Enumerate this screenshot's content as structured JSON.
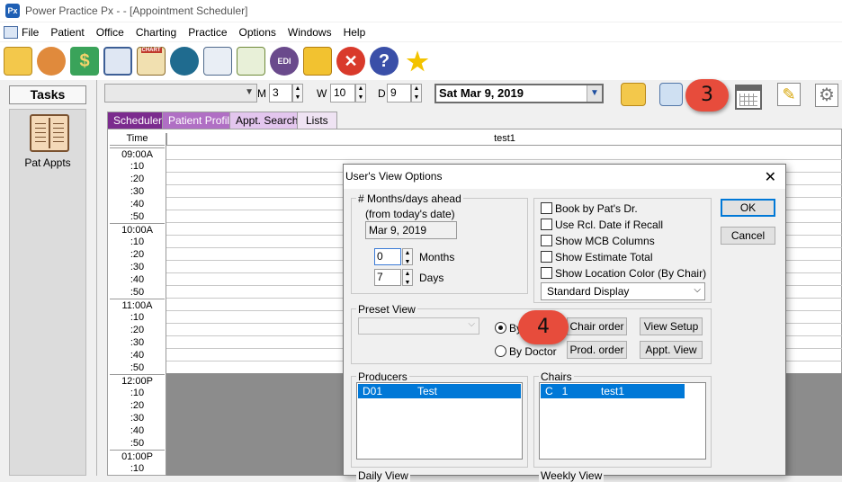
{
  "window": {
    "app_icon_text": "Px",
    "title": "Power Practice Px -  - [Appointment Scheduler]"
  },
  "menu": [
    "File",
    "Patient",
    "Office",
    "Charting",
    "Practice",
    "Options",
    "Windows",
    "Help"
  ],
  "toolbar_icons": [
    "open-folder-icon",
    "patients-icon",
    "money-icon",
    "book-icon",
    "chart-icon",
    "camera-icon",
    "mail-icon",
    "checklist-icon",
    "edi-icon",
    "gift-icon",
    "close-icon",
    "help-icon",
    "star-icon"
  ],
  "toolbar_labels": {
    "chart": "CHART",
    "edi": "EDI"
  },
  "sidebar": {
    "tasks": "Tasks",
    "item": "Pat Appts"
  },
  "controls": {
    "m_label": "M",
    "m_value": "3",
    "w_label": "W",
    "w_value": "10",
    "d_label": "D",
    "d_value": "9",
    "date": "Sat  Mar 9, 2019"
  },
  "tabs": [
    "Scheduler",
    "Patient Profile",
    "Appt. Search",
    "Lists"
  ],
  "grid": {
    "time_header": "Time",
    "column_header": "test1",
    "times": [
      "09:00A",
      ":10",
      ":20",
      ":30",
      ":40",
      ":50",
      "10:00A",
      ":10",
      ":20",
      ":30",
      ":40",
      ":50",
      "11:00A",
      ":10",
      ":20",
      ":30",
      ":40",
      ":50",
      "12:00P",
      ":10",
      ":20",
      ":30",
      ":40",
      ":50",
      "01:00P",
      ":10"
    ]
  },
  "callouts": {
    "step3": "3",
    "step4": "4"
  },
  "dialog": {
    "title": "User's View Options",
    "close": "✕",
    "months_group": "# Months/days ahead",
    "from_label": "(from today's date)",
    "from_date": "Mar 9, 2019",
    "months_value": "0",
    "months_label": "Months",
    "days_value": "7",
    "days_label": "Days",
    "checks": [
      "Book by Pat's Dr.",
      "Use Rcl. Date if Recall",
      "Show MCB Columns",
      "Show Estimate Total",
      "Show Location Color (By Chair)"
    ],
    "display_select": "Standard Display",
    "ok": "OK",
    "cancel": "Cancel",
    "preset_group": "Preset View",
    "by_chair_partial": "By",
    "by_doctor": "By Doctor",
    "chair_order": "Chair order",
    "prod_order": "Prod. order",
    "view_setup": "View Setup",
    "appt_view": "Appt. View",
    "producers_group": "Producers",
    "producer_code": "D01",
    "producer_name": "Test",
    "chairs_group": "Chairs",
    "chair_code": "C   1",
    "chair_name": "test1",
    "daily_view": "Daily View",
    "weekly_view": "Weekly View"
  }
}
